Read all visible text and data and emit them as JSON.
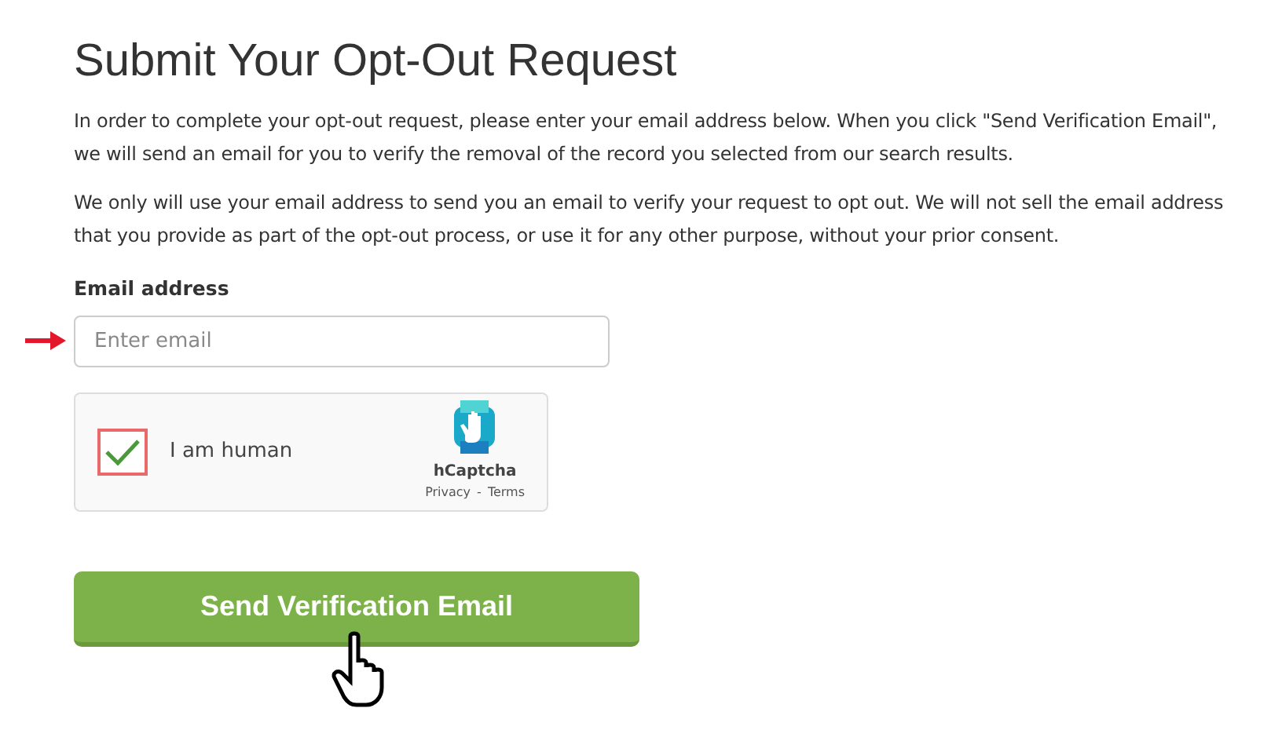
{
  "title": "Submit Your Opt-Out Request",
  "paragraphs": [
    "In order to complete your opt-out request, please enter your email address below. When you click \"Send Verification Email\", we will send an email for you to verify the removal of the record you selected from our search results.",
    "We only will use your email address to send you an email to verify your request to opt out. We will not sell the email address that you provide as part of the opt-out process, or use it for any other purpose, without your prior consent."
  ],
  "email": {
    "label": "Email address",
    "placeholder": "Enter email"
  },
  "captcha": {
    "checked": true,
    "label": "I am human",
    "brand": "hCaptcha",
    "links": [
      "Privacy",
      "-",
      "Terms"
    ]
  },
  "submit_button": {
    "label": "Send Verification Email"
  }
}
